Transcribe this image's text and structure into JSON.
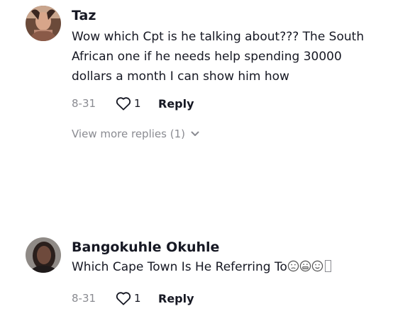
{
  "comments": [
    {
      "username": "Taz",
      "text": "Wow which Cpt is he talking about??? The South African one if he needs help spending 30000 dollars a month I can show him how",
      "date": "8-31",
      "likes": "1",
      "reply_label": "Reply",
      "view_more_label": "View more replies (1)"
    },
    {
      "username": "Bangokuhle Okuhle",
      "text": "Which Cape Town Is He Referring To",
      "emojis": [
        "confused-face",
        "grimacing-face",
        "slightly-smiling-face",
        "unknown-glyph"
      ],
      "date": "8-31",
      "likes": "1",
      "reply_label": "Reply"
    }
  ],
  "colors": {
    "primary_text": "#161823",
    "secondary_text": "#8a8b91",
    "background": "#ffffff"
  }
}
